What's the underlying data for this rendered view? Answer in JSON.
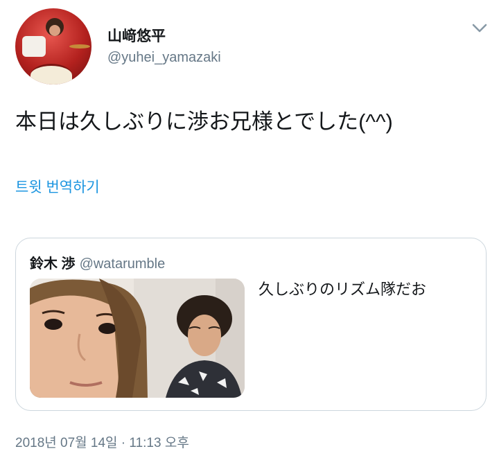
{
  "tweet": {
    "author": {
      "name": "山﨑悠平",
      "handle": "@yuhei_yamazaki"
    },
    "text": "本日は久しぶりに渉お兄様とでした(^^)",
    "translate_label": "트윗 번역하기",
    "timestamp": "2018년 07월 14일 · 11:13 오후",
    "menu_icon": "chevron-down-icon"
  },
  "quoted": {
    "author": {
      "name": "鈴木 渉",
      "handle": "@watarumble"
    },
    "text": "久しぶりのリズム隊だお"
  },
  "colors": {
    "link": "#1b95e0",
    "secondary_text": "#657786",
    "border": "#ccd6dd",
    "primary_text": "#14171a"
  }
}
